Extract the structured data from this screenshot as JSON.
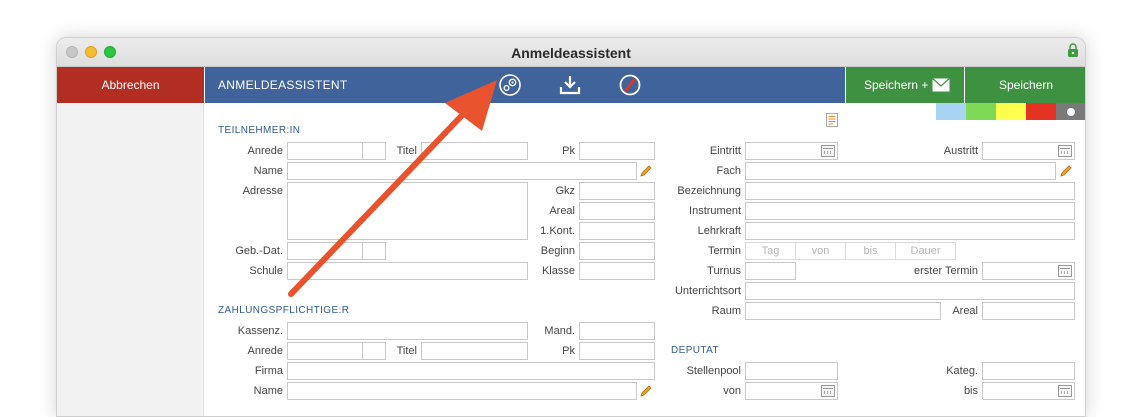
{
  "window": {
    "title": "Anmeldeassistent"
  },
  "toolbar": {
    "cancel_label": "Abbrechen",
    "bar_title": "ANMELDEASSISTENT",
    "save_mail_label": "Speichern +",
    "save_label": "Speichern",
    "status_colors": [
      "#a7d4f2",
      "#7ed957",
      "#ffff4d",
      "#e53323",
      "#7a7a7a"
    ]
  },
  "participant": {
    "section": "TEILNEHMER:IN",
    "anrede": "Anrede",
    "titel": "Titel",
    "pk": "Pk",
    "name": "Name",
    "adresse": "Adresse",
    "gkz": "Gkz",
    "areal": "Areal",
    "kont": "1.Kont.",
    "geb": "Geb.-Dat.",
    "beginn": "Beginn",
    "schule": "Schule",
    "klasse": "Klasse"
  },
  "payer": {
    "section": "ZAHLUNGSPFLICHTIGE:R",
    "kassenz": "Kassenz.",
    "mand": "Mand.",
    "anrede": "Anrede",
    "titel": "Titel",
    "pk": "Pk",
    "firma": "Firma",
    "name": "Name"
  },
  "course": {
    "eintritt": "Eintritt",
    "austritt": "Austritt",
    "fach": "Fach",
    "bezeichnung": "Bezeichnung",
    "instrument": "Instrument",
    "lehrkraft": "Lehrkraft",
    "termin": "Termin",
    "termin_tag": "Tag",
    "termin_von": "von",
    "termin_bis": "bis",
    "termin_dauer": "Dauer",
    "turnus": "Turnus",
    "erster_termin": "erster Termin",
    "unterrichtsort": "Unterrichtsort",
    "raum": "Raum",
    "areal": "Areal"
  },
  "deputat": {
    "section": "DEPUTAT",
    "stellenpool": "Stellenpool",
    "kateg": "Kateg.",
    "von": "von",
    "bis": "bis"
  }
}
